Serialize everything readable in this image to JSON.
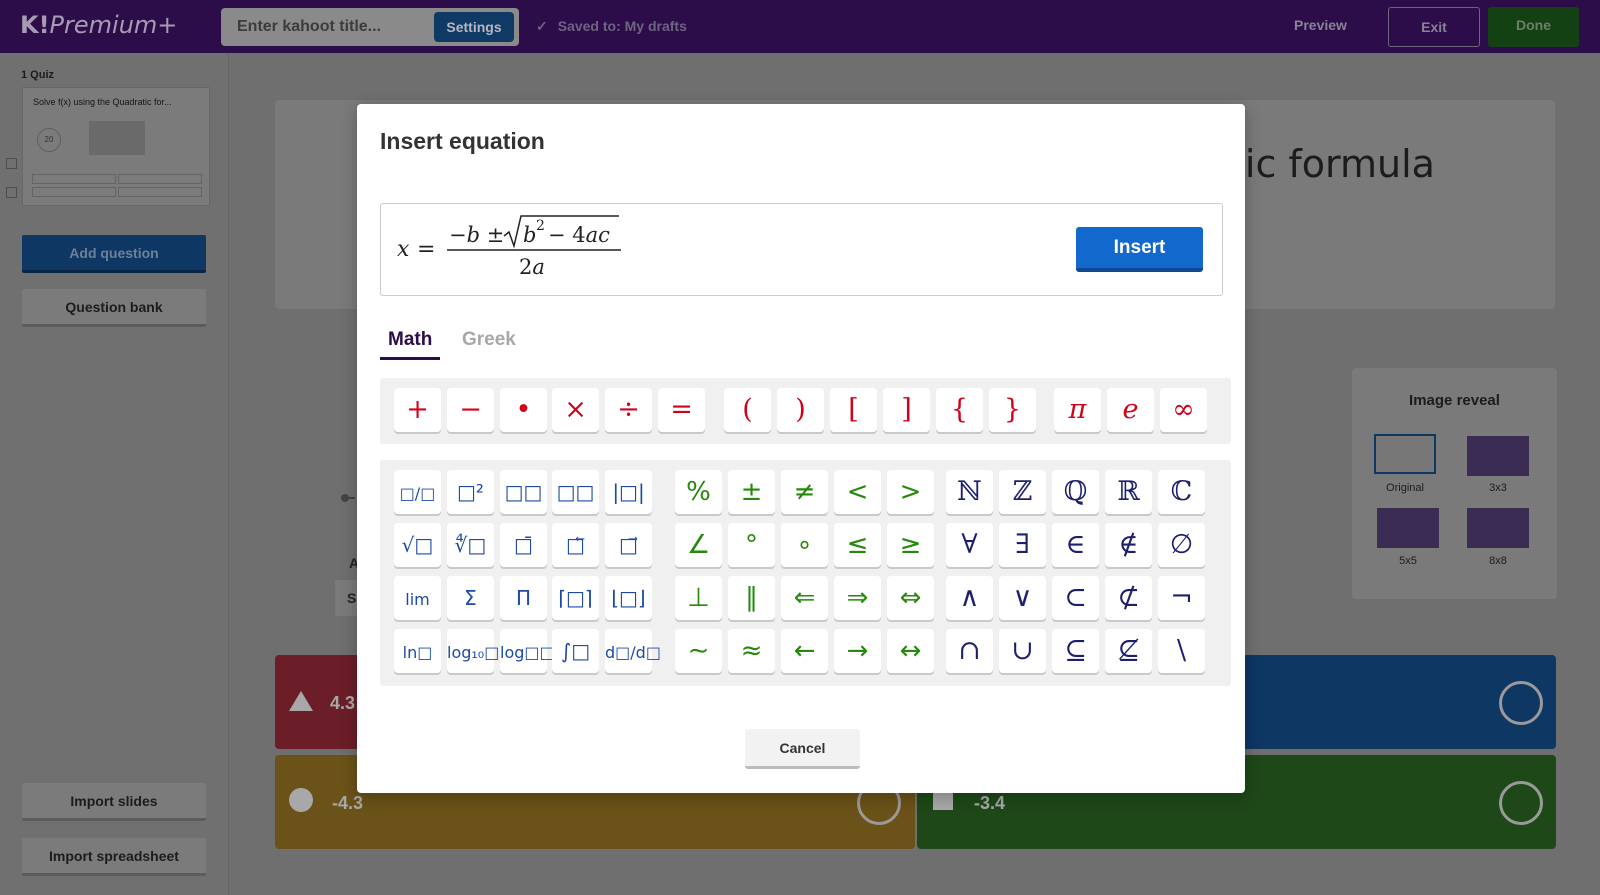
{
  "topbar": {
    "logo": "K!",
    "logo_suffix": "Premium+",
    "title_placeholder": "Enter kahoot title...",
    "settings_label": "Settings",
    "saved_label": "Saved to: My drafts",
    "preview_label": "Preview",
    "exit_label": "Exit",
    "done_label": "Done"
  },
  "sidebar": {
    "slide_label": "1  Quiz",
    "thumb_title": "Solve  f(x) using the Quadratic for...",
    "thumb_timer": "20",
    "add_question": "Add question",
    "question_bank": "Question bank",
    "import_slides": "Import slides",
    "import_spreadsheet": "Import spreadsheet"
  },
  "editor": {
    "title_fragment": "tic formula",
    "image_reveal": {
      "title": "Image reveal",
      "options": [
        "Original",
        "3x3",
        "5x5",
        "8x8"
      ],
      "selected": "Original"
    },
    "answers": [
      {
        "text": "4.3",
        "color": "#e21b3c",
        "shape": "triangle"
      },
      {
        "text": "",
        "color": "#1368ce",
        "shape": "diamond"
      },
      {
        "text": "-4.3",
        "color": "#d89e00",
        "shape": "circle"
      },
      {
        "text": "-3.4",
        "color": "#26890c",
        "shape": "square"
      }
    ]
  },
  "modal": {
    "title": "Insert equation",
    "equation_latex": "x = \\frac{-b \\pm \\sqrt{b^2 - 4ac}}{2a}",
    "insert_label": "Insert",
    "tabs": [
      {
        "label": "Math",
        "active": true
      },
      {
        "label": "Greek",
        "active": false
      }
    ],
    "row1_keys": [
      "+",
      "−",
      "•",
      "×",
      "÷",
      "=",
      "(",
      ")",
      "[",
      "]",
      "{",
      "}",
      "π",
      "e",
      "∞"
    ],
    "template_keys": [
      [
        "□/□",
        "□²",
        "□□",
        "□□",
        "|□|"
      ],
      [
        "√□",
        "∜□",
        "□̄",
        "□⃖",
        "□⃗"
      ],
      [
        "lim",
        "Σ",
        "Π",
        "⌈□⌉",
        "⌊□⌋"
      ],
      [
        "ln□",
        "log₁₀□",
        "log□□",
        "∫□",
        "d□/d□"
      ]
    ],
    "relation_keys": [
      [
        "%",
        "±",
        "≠",
        "<",
        ">"
      ],
      [
        "∠",
        "°",
        "∘",
        "≤",
        "≥"
      ],
      [
        "⊥",
        "∥",
        "⇐",
        "⇒",
        "⇔"
      ],
      [
        "∼",
        "≈",
        "←",
        "→",
        "↔"
      ]
    ],
    "set_keys": [
      [
        "ℕ",
        "ℤ",
        "ℚ",
        "ℝ",
        "ℂ"
      ],
      [
        "∀",
        "∃",
        "∈",
        "∉",
        "∅"
      ],
      [
        "∧",
        "∨",
        "⊂",
        "⊄",
        "¬"
      ],
      [
        "∩",
        "∪",
        "⊆",
        "⊈",
        "\\"
      ]
    ],
    "cancel_label": "Cancel"
  },
  "colors": {
    "topbar": "#2c0d4a",
    "insert": "#1368ce",
    "red_keys": "#d0021b",
    "blue_keys": "#1d4aa6",
    "green_keys": "#26890c",
    "navy_keys": "#1c1f6e"
  }
}
